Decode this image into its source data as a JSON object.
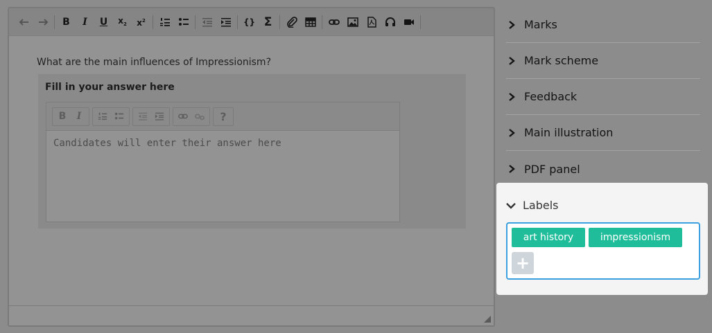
{
  "editor": {
    "toolbar": {
      "bold": "B",
      "italic": "I",
      "underline": "U",
      "subscript": "x",
      "subscript_mark": "2",
      "superscript": "x",
      "superscript_mark": "2",
      "code": "{}",
      "sum": "Σ"
    },
    "question": "What are the main influences of Impressionism?",
    "answer_title": "Fill in your answer here",
    "inner_toolbar": {
      "bold": "B",
      "italic": "I",
      "help": "?"
    },
    "answer_placeholder": "Candidates will enter their answer here"
  },
  "panel": {
    "items": [
      {
        "label": "Marks"
      },
      {
        "label": "Mark scheme"
      },
      {
        "label": "Feedback"
      },
      {
        "label": "Main illustration"
      },
      {
        "label": "PDF panel"
      }
    ],
    "labels_section": {
      "title": "Labels",
      "tags": [
        "art history",
        "impressionism"
      ],
      "add_label": "+"
    }
  },
  "colors": {
    "tag": "#1fbd9a",
    "focus_border": "#3b9fe0",
    "overlay": "#8c8c8c"
  }
}
